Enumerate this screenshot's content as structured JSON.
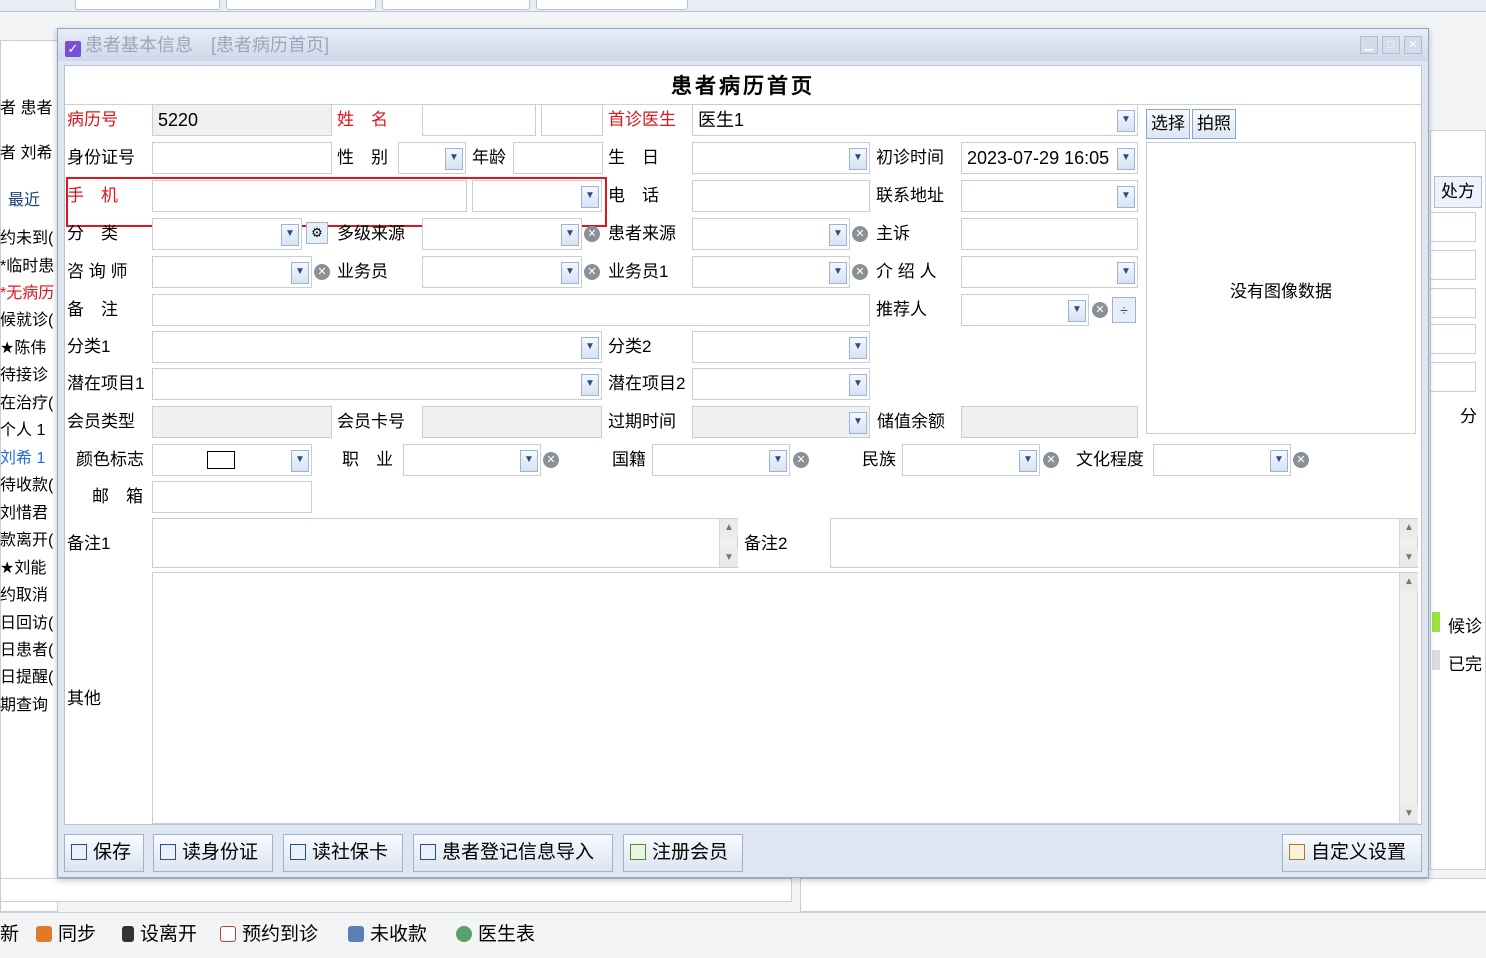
{
  "background": {
    "left_list": [
      "者 患者",
      "者 刘希",
      "最近",
      "约未到(",
      "*临时患",
      "*无病历",
      "候就诊(",
      "★陈伟",
      "待接诊",
      "在治疗(",
      "个人 1",
      "刘希 1",
      "待收款(",
      "刘惜君",
      "款离开(",
      "★刘能",
      "约取消",
      "日回访(",
      "日患者(",
      "日提醒(",
      "期查询"
    ],
    "right_tab": "处方",
    "right_items": [
      "分",
      "候诊",
      "已完"
    ]
  },
  "dialog": {
    "title": "患者基本信息",
    "subtitle": "[患者病历首页]",
    "form_title": "患者病历首页",
    "no_image": "没有图像数据"
  },
  "fields": {
    "record_no_label": "病历号",
    "record_no": "5220",
    "name_label": "姓　名",
    "first_doctor_label": "首诊医生",
    "first_doctor": "医生1",
    "select_btn": "选择",
    "photo_btn": "拍照",
    "id_label": "身份证号",
    "gender_label": "性　别",
    "age_label": "年龄",
    "birthday_label": "生　日",
    "first_visit_label": "初诊时间",
    "first_visit": "2023-07-29 16:05",
    "mobile_label": "手　机",
    "phone_label": "电　话",
    "address_label": "联系地址",
    "category_label": "分　类",
    "multi_source_label": "多级来源",
    "patient_source_label": "患者来源",
    "complaint_label": "主诉",
    "consultant_label": "咨 询 师",
    "salesman_label": "业务员",
    "salesman1_label": "业务员1",
    "introducer_label": "介 绍 人",
    "remark_label": "备　注",
    "referrer_label": "推荐人",
    "category1_label": "分类1",
    "category2_label": "分类2",
    "potential1_label": "潜在项目1",
    "potential2_label": "潜在项目2",
    "member_type_label": "会员类型",
    "member_card_label": "会员卡号",
    "expire_label": "过期时间",
    "balance_label": "储值余额",
    "color_label": "颜色标志",
    "job_label": "职　业",
    "nationality_label": "国籍",
    "ethnic_label": "民族",
    "education_label": "文化程度",
    "email_label": "邮　箱",
    "remark1_label": "备注1",
    "remark2_label": "备注2",
    "other_label": "其他"
  },
  "buttons": {
    "save": "保存",
    "read_id": "读身份证",
    "read_social": "读社保卡",
    "import": "患者登记信息导入",
    "register": "注册会员",
    "custom": "自定义设置"
  },
  "statusbar": [
    "新",
    "同步",
    "设离开",
    "预约到诊",
    "未收款",
    "医生表"
  ],
  "colors": {
    "required_label": "#e0141b",
    "highlight_box": "#e0141b",
    "dialog_border": "#93a6c7"
  }
}
